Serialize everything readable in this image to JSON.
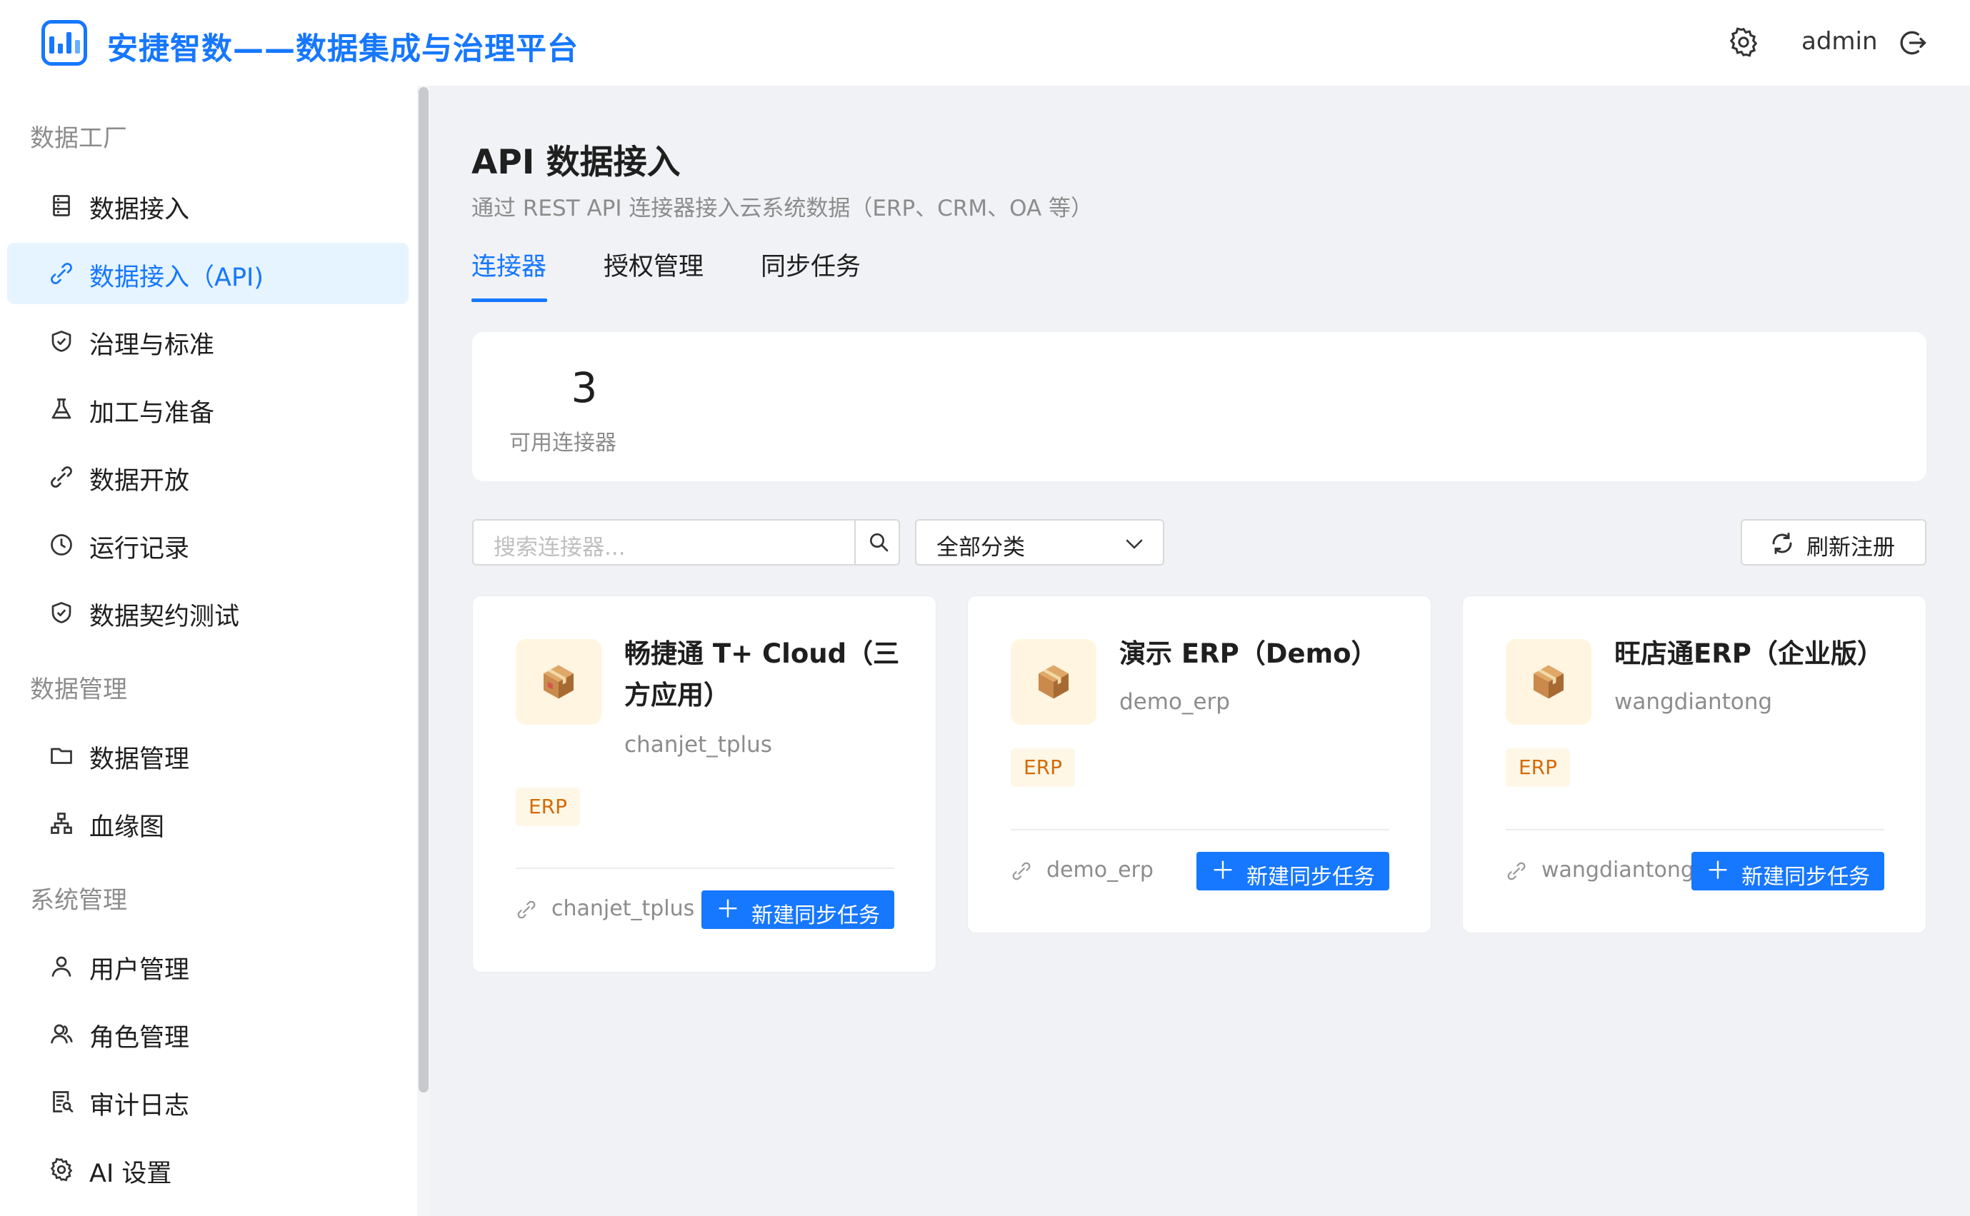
{
  "header": {
    "app_title": "安捷智数——数据集成与治理平台",
    "username": "admin",
    "icons": [
      "app-logo",
      "gear-icon",
      "logout-icon"
    ]
  },
  "sidebar": {
    "groups": [
      {
        "label": "数据工厂"
      },
      {
        "label": "数据管理"
      },
      {
        "label": "系统管理"
      }
    ],
    "items": [
      {
        "label": "数据接入",
        "icon": "database-icon"
      },
      {
        "label": "数据接入（API)",
        "icon": "api-link-icon",
        "active": true
      },
      {
        "label": "治理与标准",
        "icon": "shield-check-icon"
      },
      {
        "label": "加工与准备",
        "icon": "flask-icon"
      },
      {
        "label": "数据开放",
        "icon": "api-link-icon"
      },
      {
        "label": "运行记录",
        "icon": "clock-icon"
      },
      {
        "label": "数据契约测试",
        "icon": "shield-check-icon"
      },
      {
        "label": "数据管理",
        "icon": "folder-icon"
      },
      {
        "label": "血缘图",
        "icon": "lineage-icon"
      },
      {
        "label": "用户管理",
        "icon": "user-icon"
      },
      {
        "label": "角色管理",
        "icon": "users-icon"
      },
      {
        "label": "审计日志",
        "icon": "audit-icon"
      },
      {
        "label": "AI 设置",
        "icon": "gear-icon"
      }
    ]
  },
  "main": {
    "title": "API 数据接入",
    "subtitle": "通过 REST API 连接器接入云系统数据（ERP、CRM、OA 等）",
    "tabs": [
      {
        "label": "连接器",
        "active": true
      },
      {
        "label": "授权管理"
      },
      {
        "label": "同步任务"
      }
    ],
    "stat": {
      "value": "3",
      "label": "可用连接器"
    },
    "search": {
      "placeholder": "搜索连接器..."
    },
    "category_select": {
      "value": "全部分类"
    },
    "refresh_label": "刷新注册",
    "connectors": [
      {
        "name": "畅捷通 T+ Cloud（三方应用）",
        "code": "chanjet_tplus",
        "tag": "ERP",
        "footer_code": "chanjet_tplus",
        "button": "新建同步任务"
      },
      {
        "name": "演示 ERP（Demo）",
        "code": "demo_erp",
        "tag": "ERP",
        "footer_code": "demo_erp",
        "button": "新建同步任务"
      },
      {
        "name": "旺店通ERP（企业版）",
        "code": "wangdiantong",
        "tag": "ERP",
        "footer_code": "wangdiantong",
        "button": "新建同步任务"
      }
    ]
  },
  "colors": {
    "primary": "#1677ff",
    "tag_bg": "#fff7e6",
    "tag_text": "#d46b08",
    "active_bg": "#e6f4ff"
  }
}
